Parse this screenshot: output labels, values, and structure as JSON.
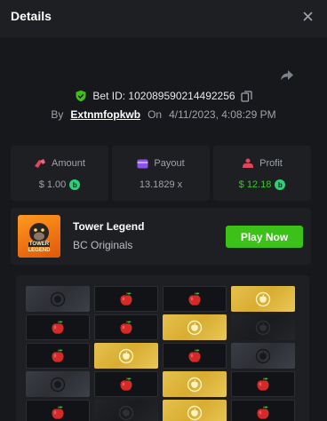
{
  "header": {
    "title": "Details"
  },
  "bet": {
    "id_text": "Bet ID: 102089590214492256",
    "by_label": "By",
    "user": "Extnmfopkwb",
    "on_label": "On",
    "datetime": "4/11/2023, 4:08:29 PM"
  },
  "stats": {
    "amount": {
      "label": "Amount",
      "value": "$ 1.00"
    },
    "payout": {
      "label": "Payout",
      "value": "13.1829 x"
    },
    "profit": {
      "label": "Profit",
      "value": "$ 12.18"
    }
  },
  "game": {
    "name": "Tower Legend",
    "provider": "BC Originals",
    "thumb_text": "TOWER LEGEND",
    "play_label": "Play Now"
  },
  "colors": {
    "background": "#17181b",
    "panel": "#1e1f23",
    "play_green": "#3bc117",
    "profit_green": "#39c52e",
    "gold": "#e6c14f"
  },
  "board": {
    "rows": [
      [
        "stone",
        "apple",
        "apple",
        "gold"
      ],
      [
        "apple",
        "apple",
        "gold",
        "dark"
      ],
      [
        "apple",
        "gold",
        "apple",
        "stone"
      ],
      [
        "stone",
        "apple",
        "gold",
        "apple"
      ],
      [
        "apple",
        "dark",
        "gold",
        "apple"
      ]
    ]
  }
}
